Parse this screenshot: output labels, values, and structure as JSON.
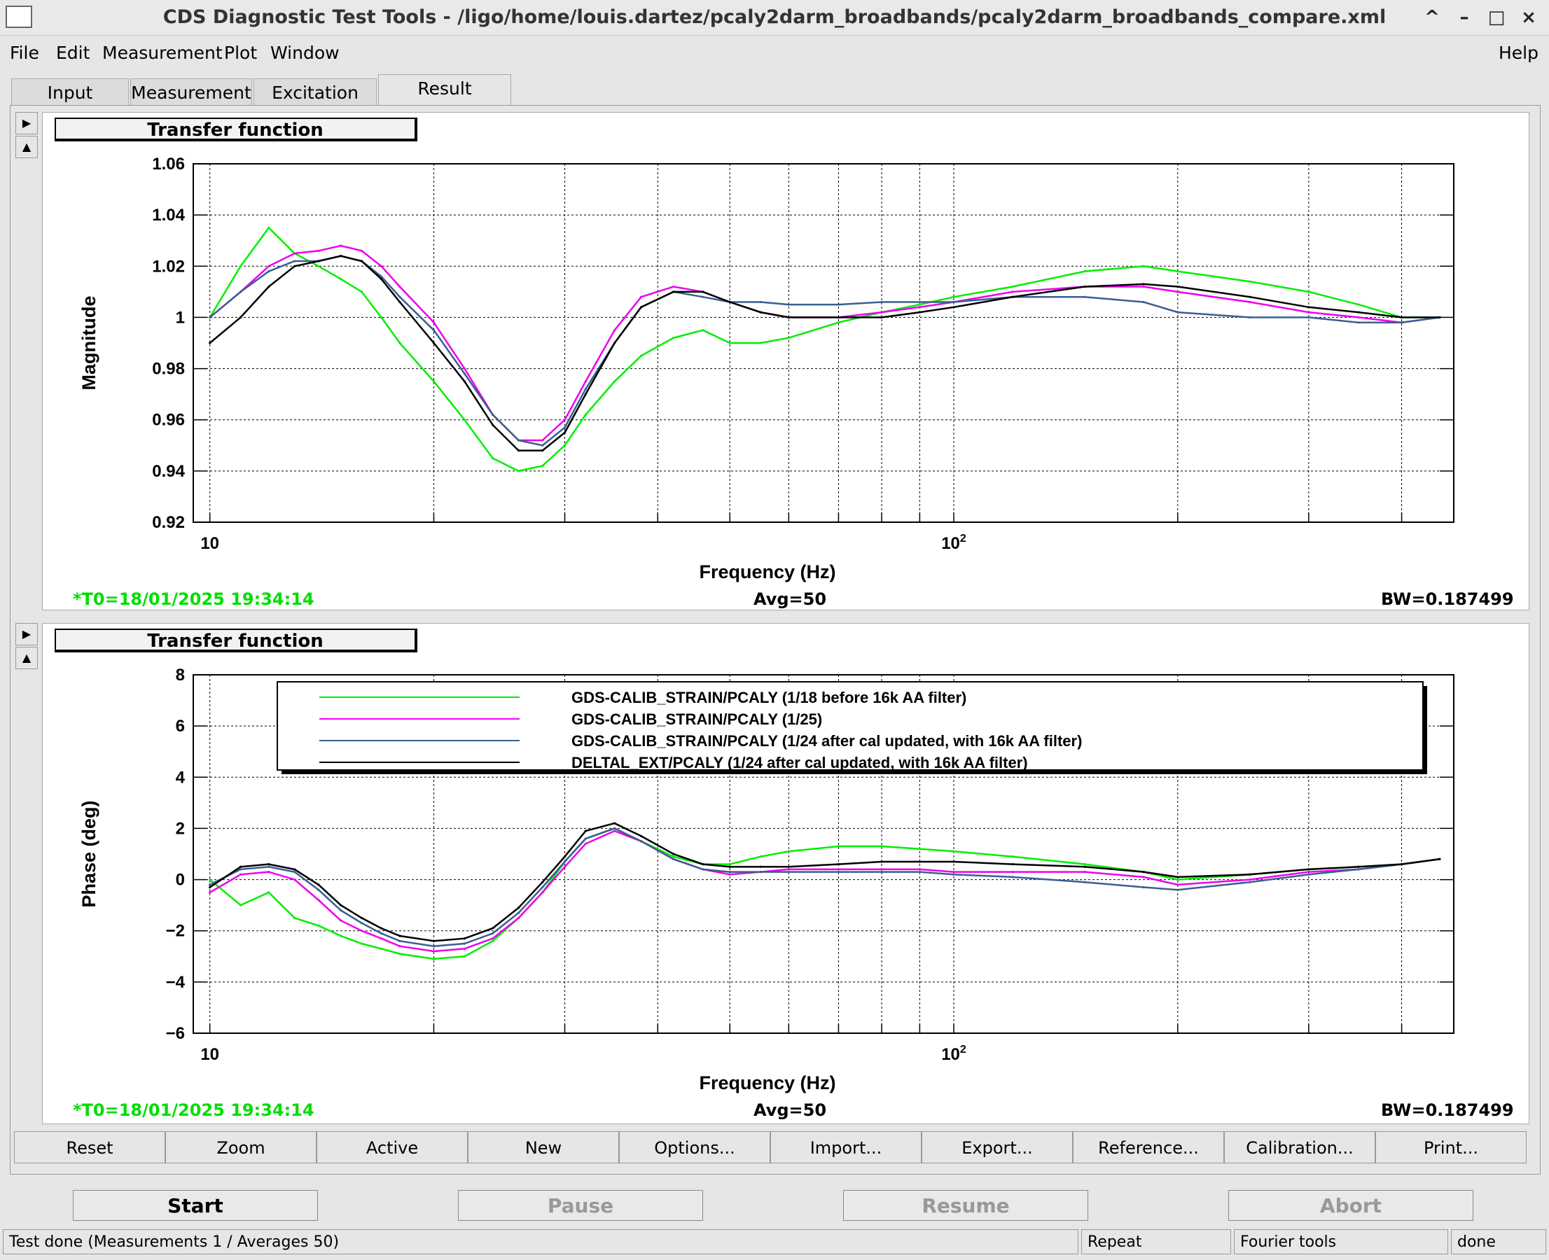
{
  "window": {
    "title": "CDS Diagnostic Test Tools - /ligo/home/louis.dartez/pcaly2darm_broadbands/pcaly2darm_broadbands_compare.xml",
    "controls": [
      "^",
      "–",
      "□",
      "×"
    ]
  },
  "menubar": {
    "file": "File",
    "edit": "Edit",
    "measurement": "Measurement",
    "plot": "Plot",
    "window": "Window",
    "help": "Help"
  },
  "tabs": [
    "Input",
    "Measurement",
    "Excitation",
    "Result"
  ],
  "active_tab": "Result",
  "panels": [
    {
      "title": "Transfer function",
      "t0": "*T0=18/01/2025 19:34:14",
      "avg": "Avg=50",
      "bw": "BW=0.187499"
    },
    {
      "title": "Transfer function",
      "t0": "*T0=18/01/2025 19:34:14",
      "avg": "Avg=50",
      "bw": "BW=0.187499"
    }
  ],
  "toolbar": [
    "Reset",
    "Zoom",
    "Active",
    "New",
    "Options...",
    "Import...",
    "Export...",
    "Reference...",
    "Calibration...",
    "Print..."
  ],
  "controls": {
    "start": "Start",
    "pause": "Pause",
    "resume": "Resume",
    "abort": "Abort"
  },
  "statusbar": {
    "message": "Test done (Measurements 1 / Averages 50)",
    "repeat": "Repeat",
    "tools": "Fourier tools",
    "state": "done"
  },
  "colors": {
    "green": "#00ee00",
    "magenta": "#ee00ee",
    "blue": "#3a5f8f",
    "black": "#000000",
    "t0_text": "#00dd00"
  },
  "chart_data": [
    {
      "type": "line",
      "title": "Transfer function",
      "xlabel": "Frequency (Hz)",
      "ylabel": "Magnitude",
      "xscale": "log",
      "xlim": [
        9.5,
        470
      ],
      "ylim": [
        0.92,
        1.06
      ],
      "yticks": [
        "0.92",
        "0.94",
        "0.96",
        "0.98",
        "1",
        "1.02",
        "1.04",
        "1.06"
      ],
      "xtick_labels": [
        "10",
        "10²"
      ],
      "grid": true,
      "x": [
        10,
        11,
        12,
        13,
        14,
        15,
        16,
        17,
        18,
        20,
        22,
        24,
        26,
        28,
        30,
        32,
        35,
        38,
        42,
        46,
        50,
        55,
        60,
        70,
        80,
        90,
        100,
        120,
        150,
        180,
        200,
        250,
        300,
        350,
        400,
        450
      ],
      "series": [
        {
          "name": "GDS-CALIB_STRAIN/PCALY (1/18 before 16k AA filter)",
          "values": [
            1.0,
            1.02,
            1.035,
            1.025,
            1.02,
            1.015,
            1.01,
            1.0,
            0.99,
            0.975,
            0.96,
            0.945,
            0.94,
            0.942,
            0.95,
            0.962,
            0.975,
            0.985,
            0.992,
            0.995,
            0.99,
            0.99,
            0.992,
            0.998,
            1.002,
            1.005,
            1.008,
            1.012,
            1.018,
            1.02,
            1.018,
            1.014,
            1.01,
            1.005,
            1.0,
            1.0
          ]
        },
        {
          "name": "GDS-CALIB_STRAIN/PCALY (1/25)",
          "values": [
            1.0,
            1.01,
            1.02,
            1.025,
            1.026,
            1.028,
            1.026,
            1.02,
            1.012,
            0.998,
            0.98,
            0.962,
            0.952,
            0.952,
            0.96,
            0.975,
            0.995,
            1.008,
            1.012,
            1.01,
            1.006,
            1.002,
            1.0,
            1.0,
            1.002,
            1.004,
            1.006,
            1.01,
            1.012,
            1.012,
            1.01,
            1.006,
            1.002,
            1.0,
            0.998,
            1.0
          ]
        },
        {
          "name": "GDS-CALIB_STRAIN/PCALY (1/24 after cal updated, with 16k AA filter)",
          "values": [
            1.0,
            1.01,
            1.018,
            1.022,
            1.022,
            1.024,
            1.022,
            1.016,
            1.008,
            0.995,
            0.978,
            0.962,
            0.952,
            0.95,
            0.957,
            0.972,
            0.99,
            1.004,
            1.01,
            1.008,
            1.006,
            1.006,
            1.005,
            1.005,
            1.006,
            1.006,
            1.006,
            1.008,
            1.008,
            1.006,
            1.002,
            1.0,
            1.0,
            0.998,
            0.998,
            1.0
          ]
        },
        {
          "name": "DELTAL_EXT/PCALY (1/24 after cal updated, with 16k AA filter)",
          "values": [
            0.99,
            1.0,
            1.012,
            1.02,
            1.022,
            1.024,
            1.022,
            1.015,
            1.006,
            0.99,
            0.975,
            0.958,
            0.948,
            0.948,
            0.955,
            0.97,
            0.99,
            1.004,
            1.01,
            1.01,
            1.006,
            1.002,
            1.0,
            1.0,
            1.0,
            1.002,
            1.004,
            1.008,
            1.012,
            1.013,
            1.012,
            1.008,
            1.004,
            1.002,
            1.0,
            1.0
          ]
        }
      ]
    },
    {
      "type": "line",
      "title": "Transfer function",
      "xlabel": "Frequency (Hz)",
      "ylabel": "Phase (deg)",
      "xscale": "log",
      "xlim": [
        9.5,
        470
      ],
      "ylim": [
        -6,
        8
      ],
      "yticks": [
        "−6",
        "−4",
        "−2",
        "0",
        "2",
        "4",
        "6",
        "8"
      ],
      "xtick_labels": [
        "10",
        "10²"
      ],
      "grid": true,
      "legend": "top",
      "x": [
        10,
        11,
        12,
        13,
        14,
        15,
        16,
        17,
        18,
        20,
        22,
        24,
        26,
        28,
        30,
        32,
        35,
        38,
        42,
        46,
        50,
        55,
        60,
        70,
        80,
        90,
        100,
        120,
        150,
        180,
        200,
        250,
        300,
        350,
        400,
        450
      ],
      "series": [
        {
          "name": "GDS-CALIB_STRAIN/PCALY (1/18 before 16k AA filter)",
          "values": [
            0.0,
            -1.0,
            -0.5,
            -1.5,
            -1.8,
            -2.2,
            -2.5,
            -2.7,
            -2.9,
            -3.1,
            -3.0,
            -2.4,
            -1.5,
            -0.5,
            0.7,
            1.6,
            2.0,
            1.5,
            0.9,
            0.6,
            0.6,
            0.9,
            1.1,
            1.3,
            1.3,
            1.2,
            1.1,
            0.9,
            0.6,
            0.3,
            0.0,
            0.2,
            0.4,
            0.5,
            0.6,
            0.8
          ]
        },
        {
          "name": "GDS-CALIB_STRAIN/PCALY (1/25)",
          "values": [
            -0.5,
            0.2,
            0.3,
            0.0,
            -0.8,
            -1.6,
            -2.0,
            -2.3,
            -2.6,
            -2.8,
            -2.7,
            -2.3,
            -1.5,
            -0.5,
            0.5,
            1.4,
            1.9,
            1.5,
            0.8,
            0.4,
            0.2,
            0.3,
            0.4,
            0.4,
            0.4,
            0.4,
            0.3,
            0.3,
            0.3,
            0.1,
            -0.2,
            0.0,
            0.3,
            0.4,
            0.6,
            0.8
          ]
        },
        {
          "name": "GDS-CALIB_STRAIN/PCALY (1/24 after cal updated, with 16k AA filter)",
          "values": [
            -0.2,
            0.4,
            0.5,
            0.3,
            -0.4,
            -1.2,
            -1.7,
            -2.1,
            -2.4,
            -2.6,
            -2.5,
            -2.1,
            -1.3,
            -0.3,
            0.7,
            1.6,
            2.0,
            1.5,
            0.8,
            0.4,
            0.3,
            0.3,
            0.3,
            0.3,
            0.3,
            0.3,
            0.2,
            0.1,
            -0.1,
            -0.3,
            -0.4,
            -0.1,
            0.2,
            0.4,
            0.6,
            0.8
          ]
        },
        {
          "name": "DELTAL_EXT/PCALY (1/24 after cal updated, with 16k AA filter)",
          "values": [
            -0.3,
            0.5,
            0.6,
            0.4,
            -0.2,
            -1.0,
            -1.5,
            -1.9,
            -2.2,
            -2.4,
            -2.3,
            -1.9,
            -1.1,
            -0.1,
            0.9,
            1.9,
            2.2,
            1.7,
            1.0,
            0.6,
            0.5,
            0.5,
            0.5,
            0.6,
            0.7,
            0.7,
            0.7,
            0.6,
            0.5,
            0.3,
            0.1,
            0.2,
            0.4,
            0.5,
            0.6,
            0.8
          ]
        }
      ]
    }
  ]
}
